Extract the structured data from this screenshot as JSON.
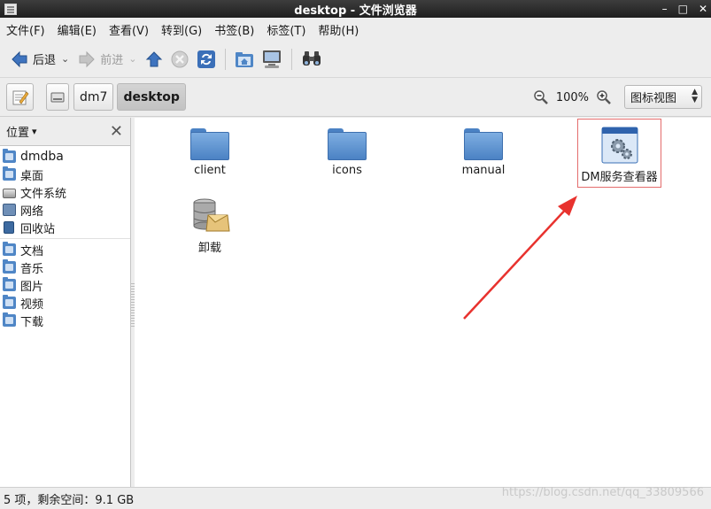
{
  "window": {
    "title": "desktop - 文件浏览器",
    "min": "–",
    "max": "□",
    "close": "✕"
  },
  "menu": [
    "文件(F)",
    "编辑(E)",
    "查看(V)",
    "转到(G)",
    "书签(B)",
    "标签(T)",
    "帮助(H)"
  ],
  "toolbar": {
    "back_label": "后退",
    "forward_label": "前进"
  },
  "location": {
    "crumbs": [
      "dm7",
      "desktop"
    ]
  },
  "zoom": {
    "level": "100%"
  },
  "view_mode": "图标视图",
  "sidebar": {
    "header": "位置",
    "items": [
      {
        "label": "dmdba",
        "icon": "home-folder-icon"
      },
      {
        "label": "桌面",
        "icon": "desktop-folder-icon"
      },
      {
        "label": "文件系统",
        "icon": "drive-icon"
      },
      {
        "label": "网络",
        "icon": "network-icon"
      },
      {
        "label": "回收站",
        "icon": "trash-icon"
      },
      {
        "label": "文档",
        "icon": "documents-folder-icon"
      },
      {
        "label": "音乐",
        "icon": "music-folder-icon"
      },
      {
        "label": "图片",
        "icon": "pictures-folder-icon"
      },
      {
        "label": "视频",
        "icon": "videos-folder-icon"
      },
      {
        "label": "下载",
        "icon": "downloads-folder-icon"
      }
    ]
  },
  "files": [
    {
      "name": "client",
      "icon": "folder-icon"
    },
    {
      "name": "icons",
      "icon": "folder-icon"
    },
    {
      "name": "manual",
      "icon": "folder-icon"
    },
    {
      "name": "DM服务查看器",
      "icon": "service-viewer-icon"
    },
    {
      "name": "卸载",
      "icon": "uninstall-icon"
    }
  ],
  "status": "5 项，剩余空间：9.1 GB",
  "watermark": "https://blog.csdn.net/qq_33809566",
  "colors": {
    "annotation": "#e8322e",
    "folder": "#4b82c4"
  }
}
